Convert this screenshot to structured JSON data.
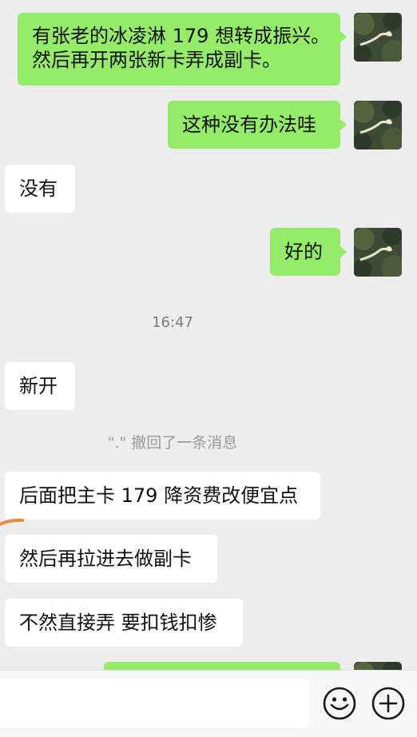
{
  "messages": [
    {
      "side": "out",
      "lines": [
        "有张老的冰凌淋 179 想转成振兴。",
        "然后再开两张新卡弄成副卡。"
      ]
    },
    {
      "side": "out",
      "text": "这种没有办法哇"
    },
    {
      "side": "in",
      "text": "没有"
    },
    {
      "side": "out",
      "text": "好的"
    },
    {
      "side": "in",
      "text": "新开"
    },
    {
      "side": "in",
      "text": "后面把主卡 179 降资费改便宜点"
    },
    {
      "side": "in",
      "text": "然后再拉进去做副卡"
    },
    {
      "side": "in",
      "text": "不然直接弄 要扣钱扣惨"
    }
  ],
  "time_label": "16:47",
  "recall_notice": "\".\" 撤回了一条消息",
  "input": {
    "value": "",
    "placeholder": ""
  },
  "icons": {
    "avatar": "plant-avatar-image",
    "emoji": "smiley-face-icon",
    "more": "plus-circle-icon"
  },
  "colors": {
    "background": "#ededed",
    "outgoing_bubble": "#95ec69",
    "incoming_bubble": "#ffffff",
    "input_bar": "#f7f7f7",
    "swipe_mark": "#f08a3a"
  }
}
